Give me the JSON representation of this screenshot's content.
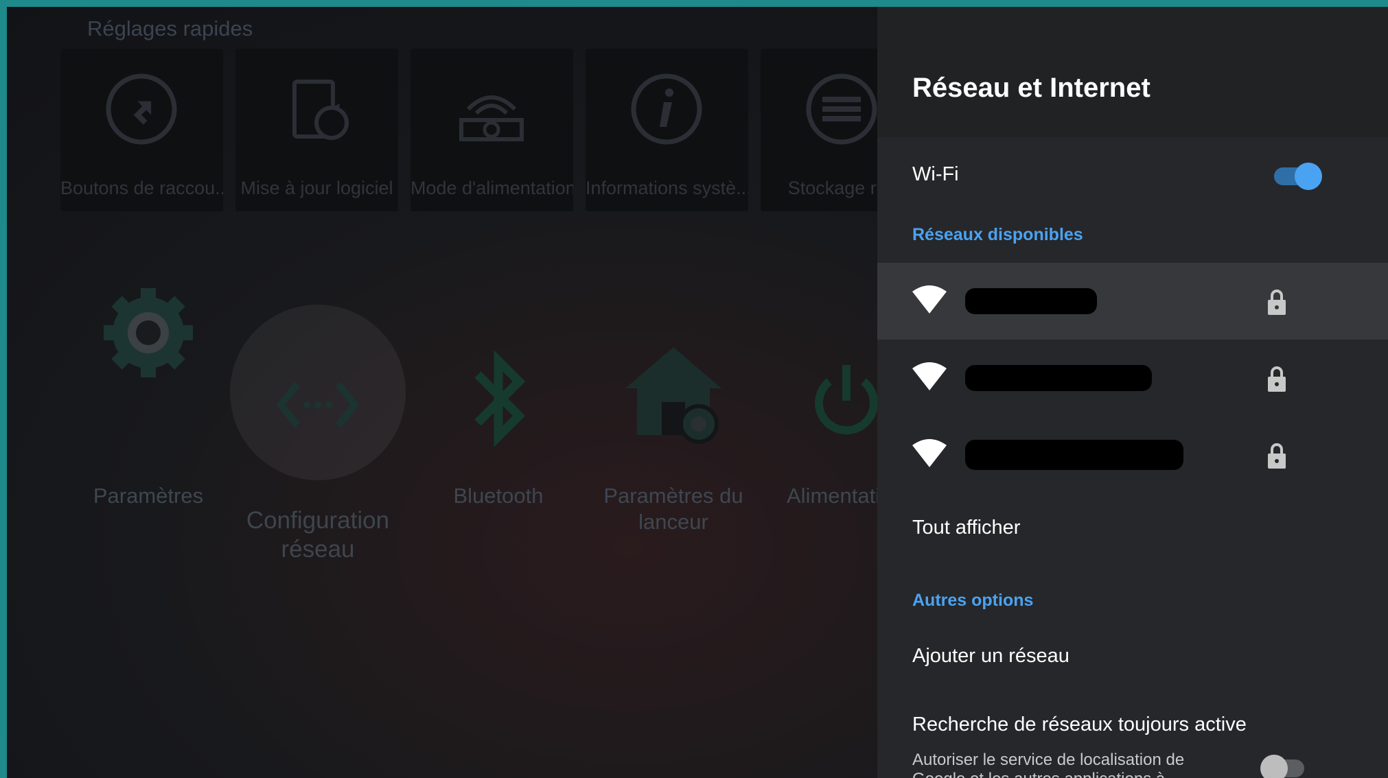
{
  "launcher": {
    "quick_settings_title": "Réglages rapides",
    "tiles": [
      {
        "label": "Boutons de raccou...",
        "icon": "shortcut-arrow-icon"
      },
      {
        "label": "Mise à jour logiciel",
        "icon": "software-update-icon"
      },
      {
        "label": "Mode d'alimentation",
        "icon": "power-mode-icon"
      },
      {
        "label": "Informations systè...",
        "icon": "info-icon"
      },
      {
        "label": "Stockage rés",
        "icon": "storage-icon"
      }
    ],
    "apps": [
      {
        "label": "Paramètres",
        "icon": "settings-gear-icon"
      },
      {
        "label": "Configuration réseau",
        "icon": "network-config-icon"
      },
      {
        "label": "Bluetooth",
        "icon": "bluetooth-icon"
      },
      {
        "label": "Paramètres du lanceur",
        "icon": "launcher-settings-icon"
      },
      {
        "label": "Alimentati",
        "icon": "power-icon"
      }
    ]
  },
  "panel": {
    "title": "Réseau et Internet",
    "wifi_label": "Wi-Fi",
    "wifi_on": true,
    "available_header": "Réseaux disponibles",
    "networks": [
      {
        "ssid": "",
        "secured": true,
        "focused": true
      },
      {
        "ssid": "",
        "secured": true,
        "focused": false
      },
      {
        "ssid": "",
        "secured": true,
        "focused": false
      }
    ],
    "show_all": "Tout afficher",
    "other_options_header": "Autres options",
    "add_network": "Ajouter un réseau",
    "always_scan_title": "Recherche de réseaux toujours active",
    "always_scan_desc": "Autoriser le service de localisation de Google et les autres applications à rechercher des",
    "always_scan_on": false
  },
  "colors": {
    "accent": "#4aa3f2",
    "toggle_on_knob": "#4aa3f2",
    "toggle_off_knob": "#bdbdbd",
    "panel_bg": "#26272a",
    "focus_row": "#37383b",
    "frame": "#1e8a8c"
  }
}
